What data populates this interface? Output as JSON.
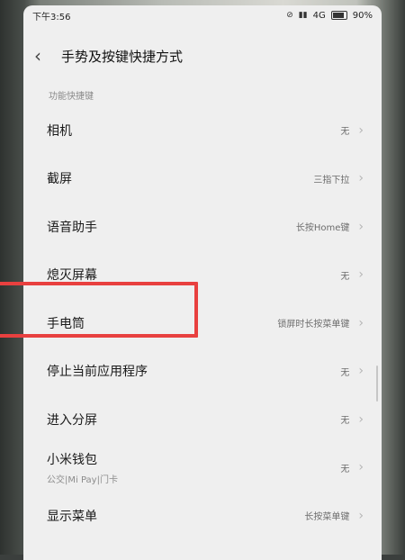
{
  "status_bar": {
    "time": "下午3:56",
    "network": "4G",
    "battery": "90%"
  },
  "header": {
    "title": "手势及按键快捷方式"
  },
  "section": {
    "label": "功能快捷键"
  },
  "items": [
    {
      "label": "相机",
      "value": "无"
    },
    {
      "label": "截屏",
      "value": "三指下拉"
    },
    {
      "label": "语音助手",
      "value": "长按Home键"
    },
    {
      "label": "熄灭屏幕",
      "value": "无"
    },
    {
      "label": "手电筒",
      "value": "锁屏时长按菜单键"
    },
    {
      "label": "停止当前应用程序",
      "value": "无"
    },
    {
      "label": "进入分屏",
      "value": "无"
    },
    {
      "label": "小米钱包",
      "sub": "公交|Mi Pay|门卡",
      "value": "无"
    },
    {
      "label": "显示菜单",
      "value": "长按菜单键"
    }
  ],
  "colors": {
    "highlight": "#e8403f",
    "background": "#efefef"
  },
  "icons": {
    "back": "back-icon",
    "chevron": "chevron-right-icon"
  }
}
